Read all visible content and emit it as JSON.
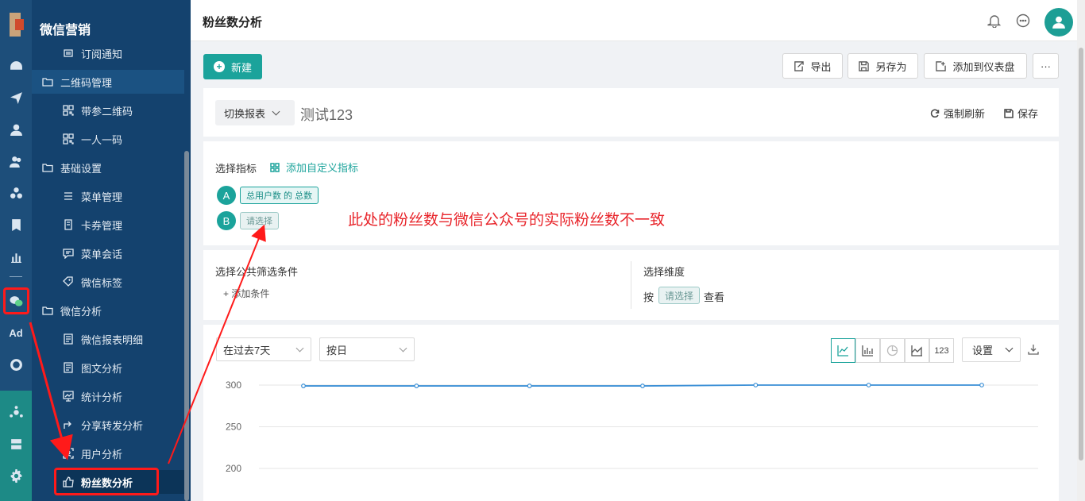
{
  "app": {
    "section_title": "微信营销"
  },
  "menu": {
    "items": [
      {
        "label": "订阅通知",
        "kind": "sub",
        "icon": "list-icon"
      },
      {
        "label": "二维码管理",
        "kind": "group",
        "icon": "folder-icon"
      },
      {
        "label": "带参二维码",
        "kind": "sub",
        "icon": "qrcode-icon"
      },
      {
        "label": "一人一码",
        "kind": "sub",
        "icon": "qrcode-icon"
      },
      {
        "label": "基础设置",
        "kind": "group",
        "icon": "folder-icon"
      },
      {
        "label": "菜单管理",
        "kind": "sub",
        "icon": "menu-list-icon"
      },
      {
        "label": "卡券管理",
        "kind": "sub",
        "icon": "coupon-icon"
      },
      {
        "label": "菜单会话",
        "kind": "sub",
        "icon": "chat-icon"
      },
      {
        "label": "微信标签",
        "kind": "sub",
        "icon": "tag-icon"
      },
      {
        "label": "微信分析",
        "kind": "group",
        "icon": "folder-icon"
      },
      {
        "label": "微信报表明细",
        "kind": "sub",
        "icon": "report-icon"
      },
      {
        "label": "图文分析",
        "kind": "sub",
        "icon": "report-icon"
      },
      {
        "label": "统计分析",
        "kind": "sub",
        "icon": "stats-icon"
      },
      {
        "label": "分享转发分析",
        "kind": "sub",
        "icon": "share-icon"
      },
      {
        "label": "用户分析",
        "kind": "sub",
        "icon": "user-scan-icon"
      },
      {
        "label": "粉丝数分析",
        "kind": "sub",
        "icon": "thumbs-up-icon"
      }
    ]
  },
  "rail": {
    "ad_label": "Ad"
  },
  "header": {
    "title": "粉丝数分析"
  },
  "toolbar": {
    "new_label": "新建",
    "export_label": "导出",
    "save_as_label": "另存为",
    "add_dashboard_label": "添加到仪表盘",
    "more_label": "···"
  },
  "report": {
    "switch_label": "切换报表",
    "name": "测试123",
    "refresh_label": "强制刷新",
    "save_label": "保存"
  },
  "metrics": {
    "title": "选择指标",
    "add_custom_label": "添加自定义指标",
    "a_letter": "A",
    "a_value": "总用户数 的 总数",
    "b_letter": "B",
    "b_value": "请选择"
  },
  "annotation": {
    "text": "此处的粉丝数与微信公众号的实际粉丝数不一致"
  },
  "filters": {
    "title": "选择公共筛选条件",
    "add_label": "添加条件"
  },
  "dimension": {
    "title": "选择维度",
    "prefix": "按",
    "select_label": "请选择",
    "suffix": "查看"
  },
  "chart_controls": {
    "range": "在过去7天",
    "granularity": "按日",
    "number_label": "123",
    "settings_label": "设置"
  },
  "chart_data": {
    "type": "line",
    "title": "",
    "xlabel": "",
    "ylabel": "",
    "x": [
      "",
      "",
      "",
      "",
      "",
      "",
      ""
    ],
    "series": [
      {
        "values": [
          299,
          299,
          299,
          299,
          300,
          300,
          300
        ]
      }
    ],
    "yticks": [
      300,
      250,
      200
    ],
    "ylim": [
      200,
      300
    ],
    "grid": true,
    "color": "#3a8fd6"
  }
}
